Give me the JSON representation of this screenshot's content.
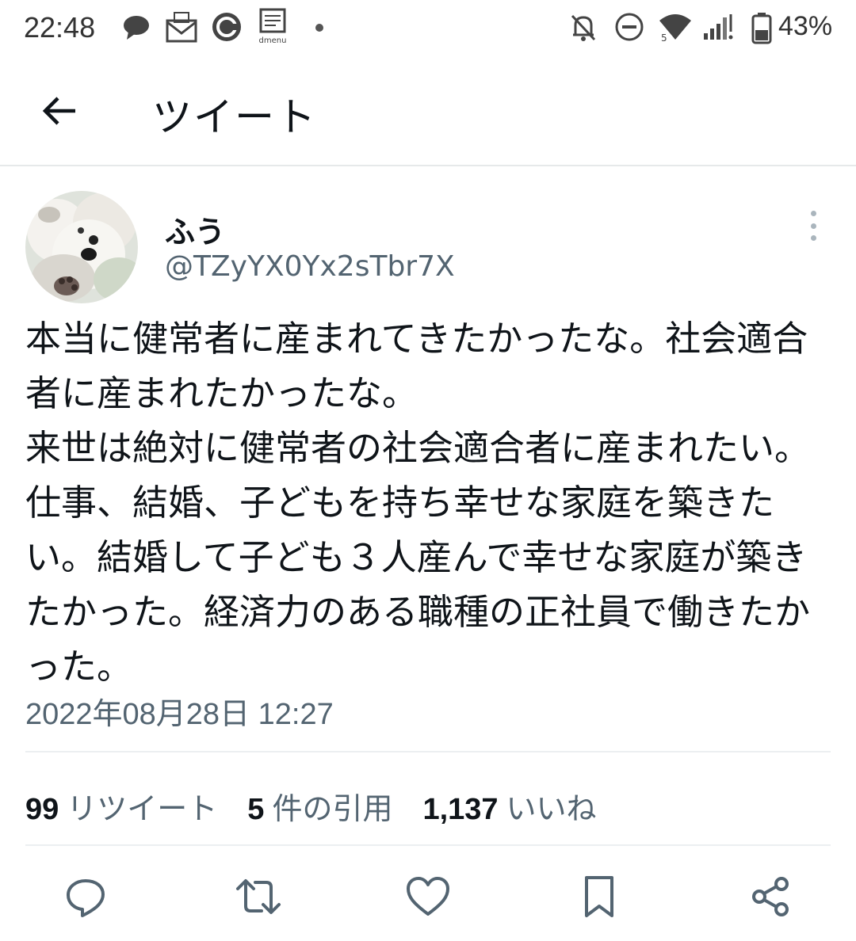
{
  "status_bar": {
    "time": "22:48",
    "left_icons": [
      "chat-bubble-icon",
      "mail-icon",
      "app-c-icon",
      "dmenu-icon"
    ],
    "right_icons": [
      "bell-off-icon",
      "do-not-disturb-icon",
      "wifi-icon",
      "signal-icon",
      "battery-icon"
    ],
    "dmenu_label": "dmenu",
    "wifi_label": "5",
    "battery": "43%"
  },
  "header": {
    "back_icon": "arrow-left-icon",
    "title": "ツイート"
  },
  "tweet": {
    "author": {
      "display_name": "ふう",
      "handle": "@TZyYX0Yx2sTbr7X"
    },
    "text": "本当に健常者に産まれてきたかったな。社会適合者に産まれたかったな。\n来世は絶対に健常者の社会適合者に産まれたい。仕事、結婚、子どもを持ち幸せな家庭を築きたい。結婚して子ども３人産んで幸せな家庭が築きたかった。経済力のある職種の正社員で働きたかった。",
    "timestamp": "2022年08月28日 12:27",
    "stats": {
      "retweets_count": "99",
      "retweets_label": "リツイート",
      "quotes_count": "5",
      "quotes_label": "件の引用",
      "likes_count": "1,137",
      "likes_label": "いいね"
    }
  },
  "actions": [
    "reply-icon",
    "retweet-icon",
    "like-icon",
    "bookmark-icon",
    "share-icon"
  ],
  "colors": {
    "text_primary": "#0f1419",
    "text_secondary": "#536471",
    "divider": "#eceff1",
    "icon": "#536471"
  }
}
